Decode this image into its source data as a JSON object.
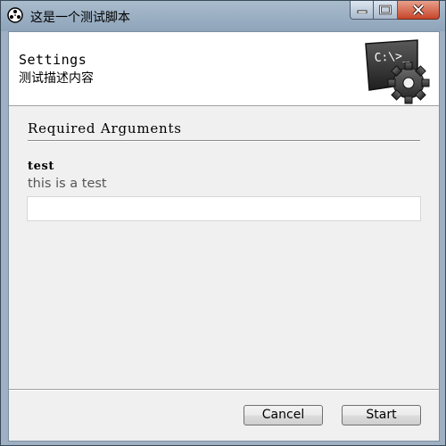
{
  "window": {
    "title": "这是一个测试脚本"
  },
  "header": {
    "title": "Settings",
    "description": "测试描述内容",
    "icon": "console-gear-icon",
    "icon_text": "C:\\>_"
  },
  "section": {
    "title": "Required Arguments"
  },
  "field": {
    "name": "test",
    "help": "this is a test",
    "value": ""
  },
  "buttons": {
    "cancel": "Cancel",
    "start": "Start"
  },
  "colors": {
    "titlebar": "#9fb0c3",
    "client_bg": "#f0f0f0",
    "header_bg": "#ffffff",
    "close_button": "#c7462a"
  }
}
